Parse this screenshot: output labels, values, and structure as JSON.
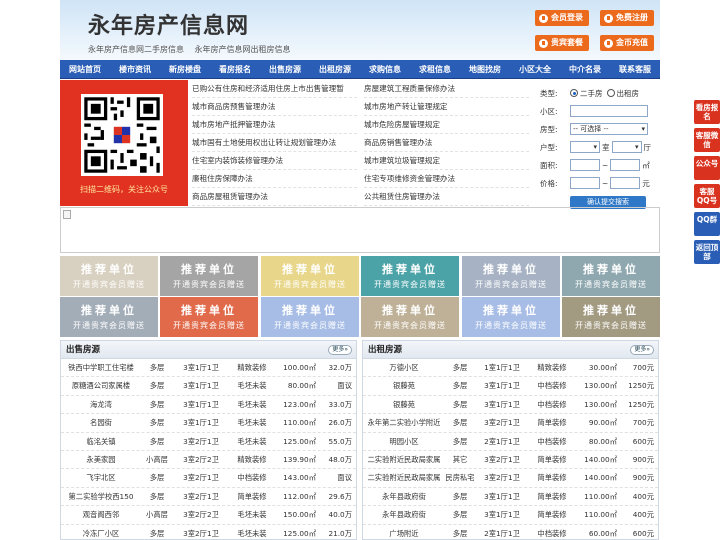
{
  "header": {
    "title": "永年房产信息网",
    "sub_links": [
      "永年房产信息网二手房信息",
      "永年房产信息网出租房信息"
    ],
    "buttons": [
      "会员登录",
      "免费注册",
      "贵宾套餐",
      "金币充值"
    ]
  },
  "nav": [
    "网站首页",
    "楼市资讯",
    "新房楼盘",
    "看房报名",
    "出售房源",
    "出租房源",
    "求购信息",
    "求租信息",
    "地图找房",
    "小区大全",
    "中介名录",
    "联系客服"
  ],
  "qr": {
    "caption": "扫描二维码，关注公众号"
  },
  "links": {
    "left": [
      "已购公有住房和经济适用住房上市出售管理暂",
      "城市商品房预售管理办法",
      "城市房地产抵押管理办法",
      "城市国有土地使用权出让转让规划管理办法",
      "住宅室内装饰装修管理办法",
      "廉租住房保障办法",
      "商品房屋租赁管理办法"
    ],
    "right": [
      "房屋建筑工程质量保修办法",
      "城市房地产转让管理规定",
      "城市危险房屋管理规定",
      "商品房销售管理办法",
      "城市建筑垃圾管理规定",
      "住宅专项维修资金管理办法",
      "公共租赁住房管理办法"
    ]
  },
  "search": {
    "type_label": "类型:",
    "type_options": [
      "二手房",
      "出租房"
    ],
    "community_label": "小区:",
    "housing_label": "房型:",
    "housing_select": "-- 可选择 --",
    "layout_label": "户型:",
    "room_unit": "室",
    "hall_unit": "厅",
    "area_label": "面积:",
    "area_unit": "㎡",
    "price_label": "价格:",
    "price_unit": "元",
    "range_sep": "~",
    "submit": "确认提交搜索"
  },
  "ads": {
    "title": "推荐单位",
    "subtitle": "开通贵宾会员赠送",
    "colors": [
      "#d8d0c0",
      "#a5a5a5",
      "#e8d68a",
      "#4ba3a8",
      "#a7b3c4",
      "#8fa8b0",
      "#a3adb8",
      "#e06a4a",
      "#a7bde6",
      "#bfb197",
      "#a7bde6",
      "#a39a82"
    ]
  },
  "sale": {
    "title": "出售房源",
    "more": "更多»",
    "rows": [
      [
        "铁西中学职工住宅楼",
        "多层",
        "3室1厅1卫",
        "精致装修",
        "100.00㎡",
        "32.0万"
      ],
      [
        "原糖酒公司家属楼",
        "多层",
        "3室1厅1卫",
        "毛坯未装",
        "80.00㎡",
        "面议"
      ],
      [
        "海龙湾",
        "多层",
        "3室1厅1卫",
        "毛坯未装",
        "123.00㎡",
        "33.0万"
      ],
      [
        "名园街",
        "多层",
        "3室1厅1卫",
        "毛坯未装",
        "110.00㎡",
        "26.0万"
      ],
      [
        "临洺关镇",
        "多层",
        "3室2厅1卫",
        "毛坯未装",
        "125.00㎡",
        "55.0万"
      ],
      [
        "永美家园",
        "小高层",
        "3室2厅2卫",
        "精致装修",
        "139.90㎡",
        "48.0万"
      ],
      [
        "飞宇北区",
        "多层",
        "3室2厅1卫",
        "中档装修",
        "143.00㎡",
        "面议"
      ],
      [
        "第二实验学校西150",
        "多层",
        "3室2厅1卫",
        "简单装修",
        "112.00㎡",
        "29.6万"
      ],
      [
        "观音阁西邻",
        "小高层",
        "3室2厅2卫",
        "毛坯未装",
        "150.00㎡",
        "40.0万"
      ],
      [
        "冷冻厂小区",
        "多层",
        "3室2厅1卫",
        "毛坯未装",
        "125.00㎡",
        "21.0万"
      ]
    ]
  },
  "rent": {
    "title": "出租房源",
    "more": "更多»",
    "rows": [
      [
        "万德小区",
        "多层",
        "1室1厅1卫",
        "精致装修",
        "30.00㎡",
        "700元"
      ],
      [
        "银藤苑",
        "多层",
        "3室1厅1卫",
        "中档装修",
        "130.00㎡",
        "1250元"
      ],
      [
        "银藤苑",
        "多层",
        "3室1厅1卫",
        "中档装修",
        "130.00㎡",
        "1250元"
      ],
      [
        "永年第二实验小学附近",
        "多层",
        "3室2厅1卫",
        "简单装修",
        "90.00㎡",
        "700元"
      ],
      [
        "明园小区",
        "多层",
        "2室1厅1卫",
        "中档装修",
        "80.00㎡",
        "600元"
      ],
      [
        "二实验附近民政局家属",
        "其它",
        "3室2厅1卫",
        "简单装修",
        "140.00㎡",
        "900元"
      ],
      [
        "二实验附近民政局家属",
        "民房私宅",
        "3室2厅1卫",
        "简单装修",
        "140.00㎡",
        "900元"
      ],
      [
        "永年县政府街",
        "多层",
        "3室1厅1卫",
        "简单装修",
        "110.00㎡",
        "400元"
      ],
      [
        "永年县政府街",
        "多层",
        "3室1厅1卫",
        "简单装修",
        "110.00㎡",
        "400元"
      ],
      [
        "广场附近",
        "多层",
        "2室1厅1卫",
        "中档装修",
        "60.00㎡",
        "600元"
      ]
    ]
  },
  "side": [
    "看房报名",
    "客服微信",
    "公众号",
    "客服QQ号",
    "QQ群",
    "返回顶部"
  ]
}
